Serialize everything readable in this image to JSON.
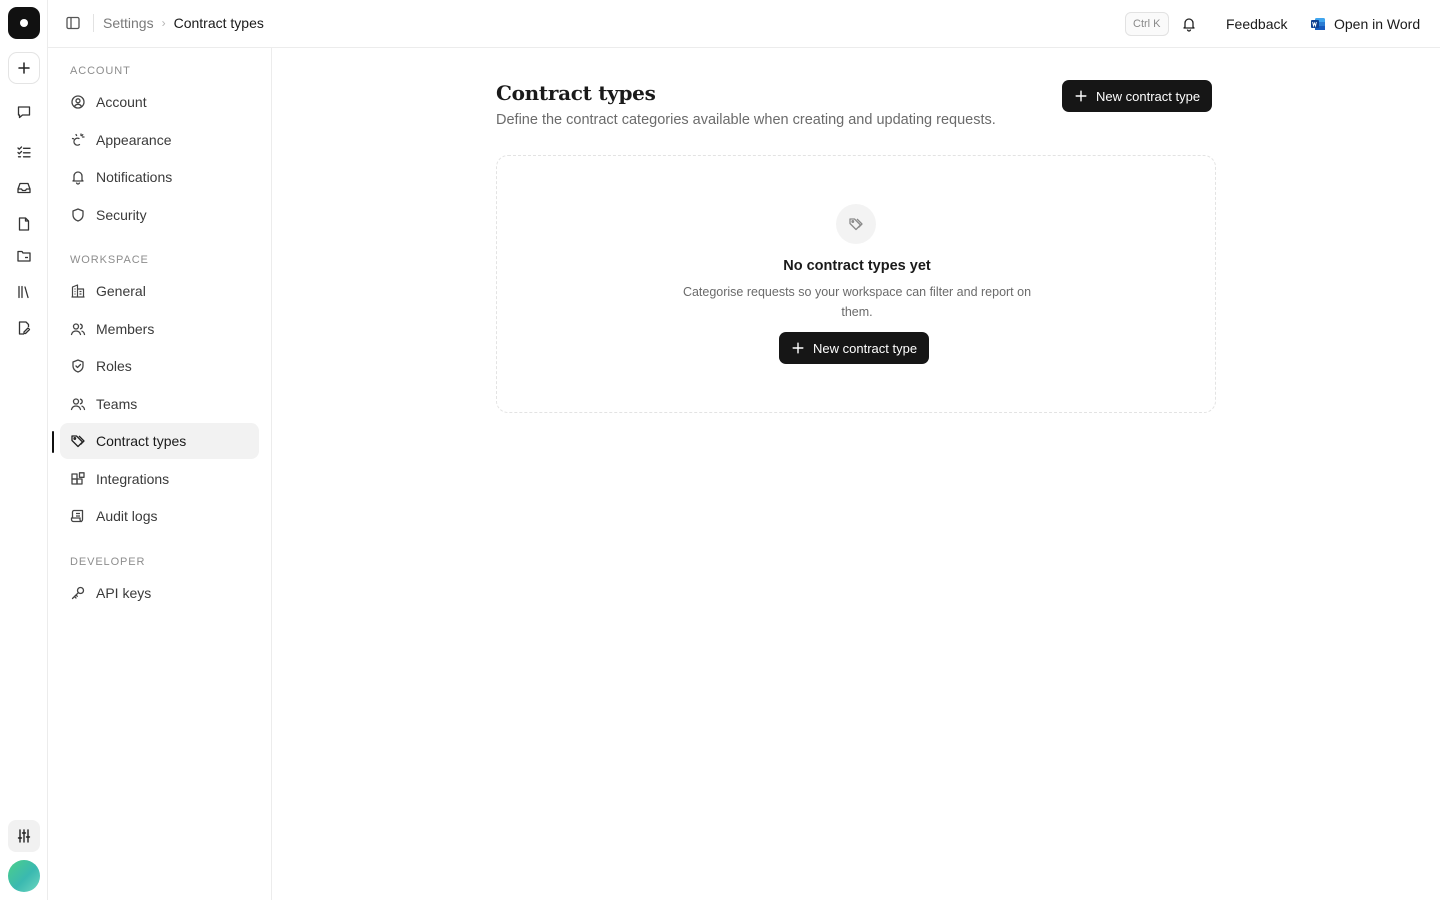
{
  "topbar": {
    "breadcrumb_parent": "Settings",
    "breadcrumb_separator": "›",
    "breadcrumb_current": "Contract types",
    "shortcut": "Ctrl K",
    "feedback_label": "Feedback",
    "open_in_word_label": "Open in Word"
  },
  "rail": {
    "icons": [
      "logo-icon",
      "plus-icon",
      "chat-icon",
      "checklist-icon",
      "inbox-icon",
      "file-icon",
      "folder-icon",
      "library-icon",
      "file-edit-icon",
      "sliders-icon",
      "avatar"
    ]
  },
  "sidebar": {
    "sections": [
      {
        "label": "ACCOUNT",
        "items": [
          "Account",
          "Appearance",
          "Notifications",
          "Security"
        ]
      },
      {
        "label": "WORKSPACE",
        "items": [
          "General",
          "Members",
          "Roles",
          "Teams",
          "Contract types",
          "Integrations",
          "Audit logs"
        ]
      },
      {
        "label": "DEVELOPER",
        "items": [
          "API keys"
        ]
      }
    ],
    "active_item": "Contract types"
  },
  "main": {
    "title": "Contract types",
    "description": "Define the contract categories available when creating and updating requests.",
    "new_button_label": "New contract type",
    "empty_state": {
      "title": "No contract types yet",
      "description": "Categorise requests so your workspace can filter and report on them.",
      "button_label": "New contract type"
    }
  },
  "colors": {
    "primary_button": "#161616",
    "active_nav_bg": "#f2f2f2",
    "border": "#ececec"
  }
}
